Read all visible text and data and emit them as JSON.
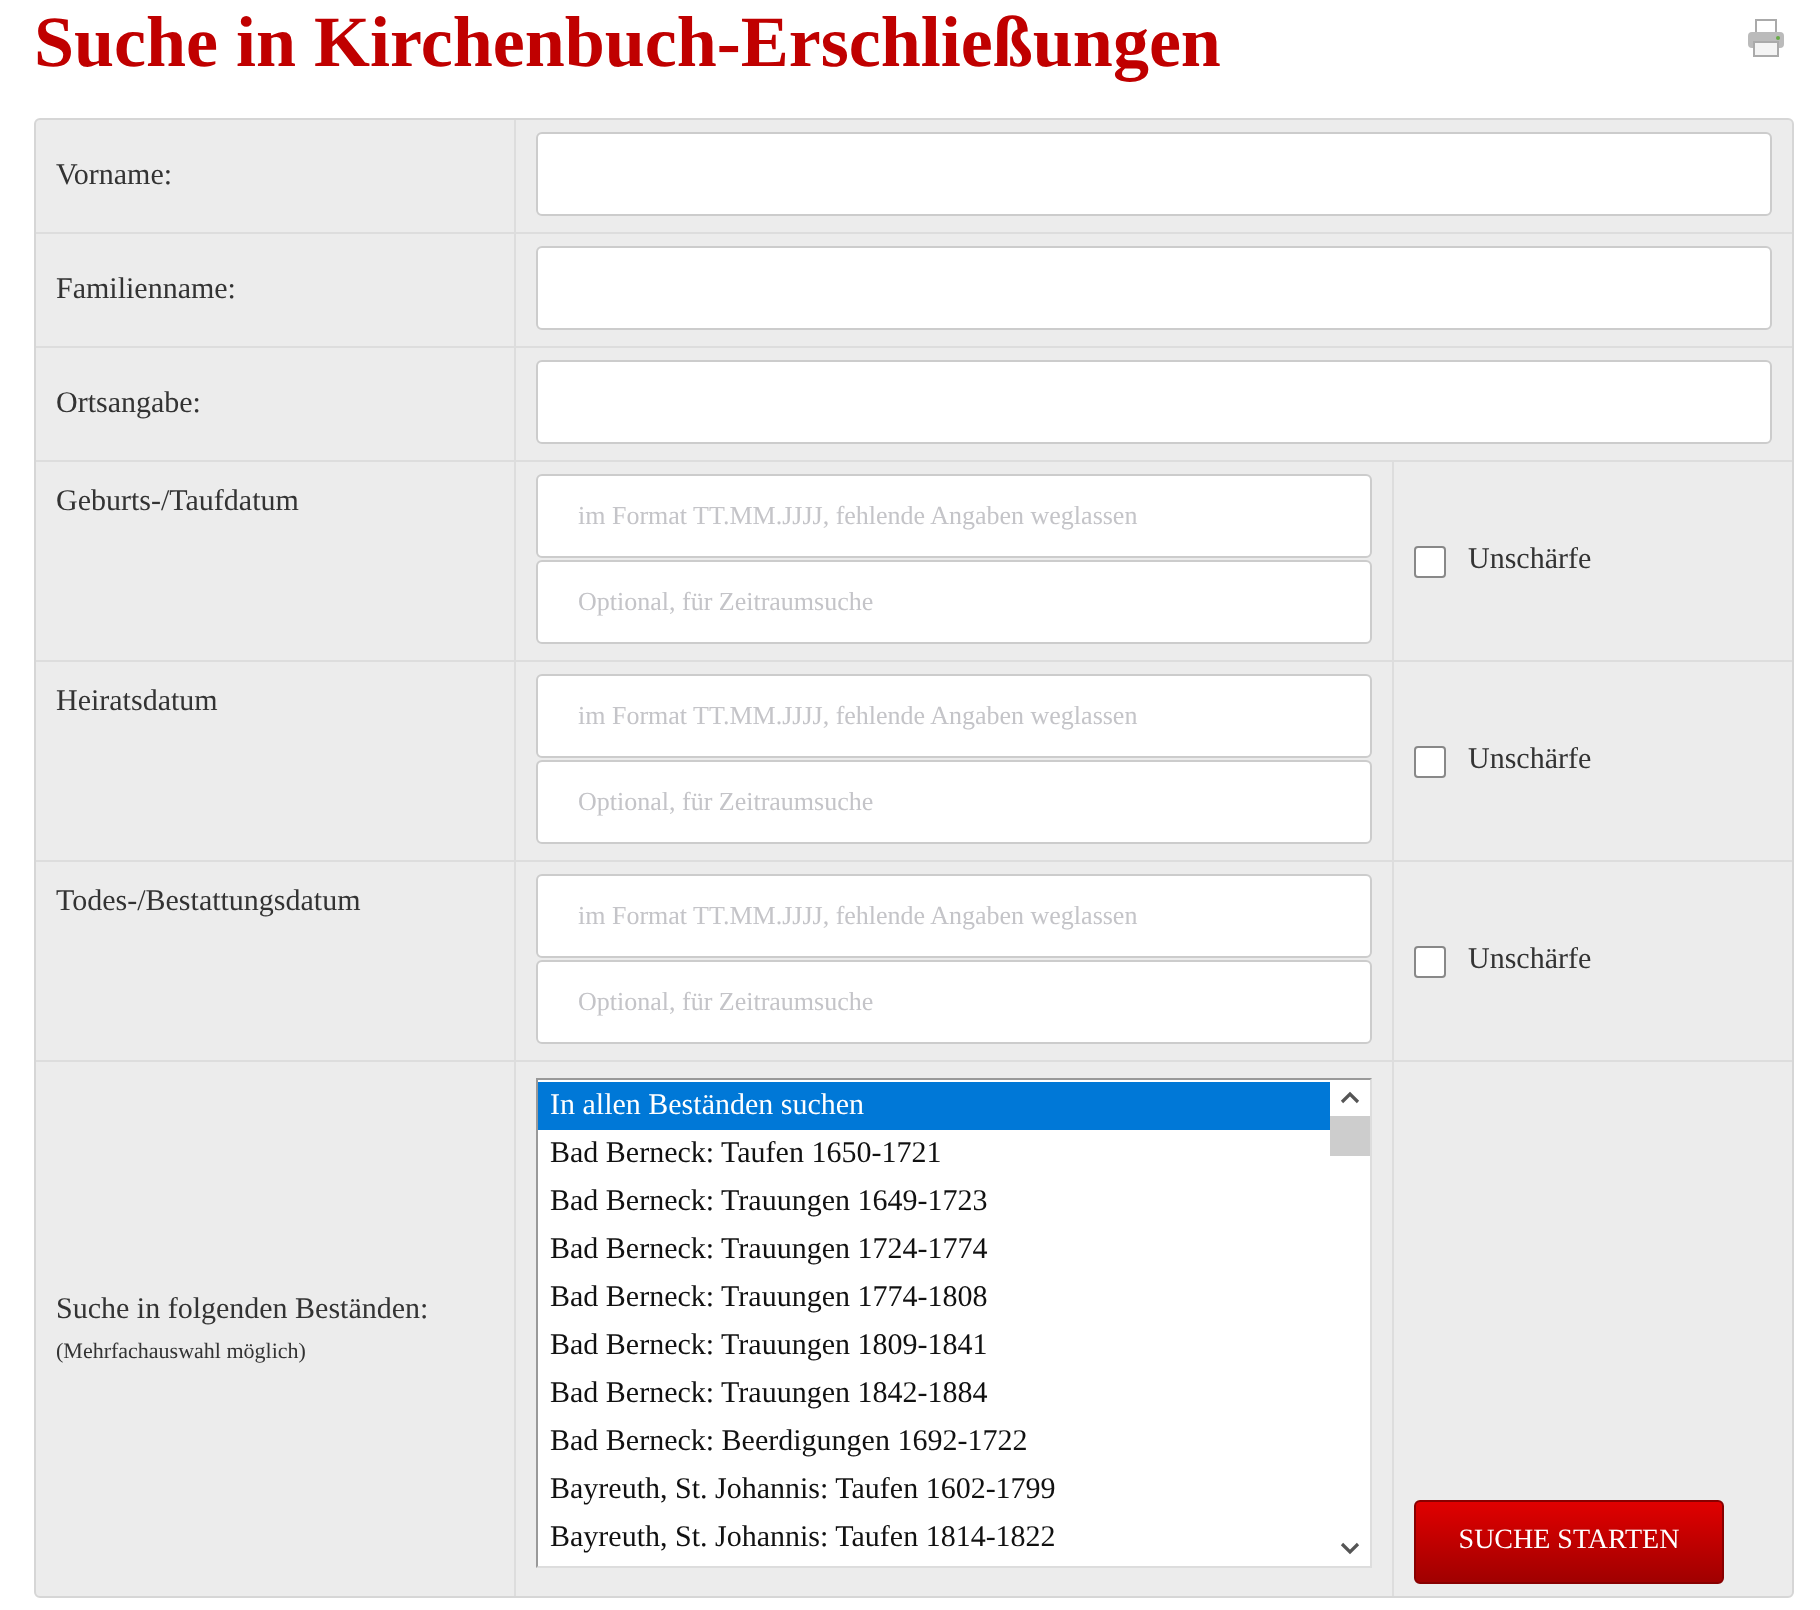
{
  "title": "Suche in Kirchenbuch-Erschließungen",
  "text_fields": [
    {
      "label": "Vorname:"
    },
    {
      "label": "Familienname:"
    },
    {
      "label": "Ortsangabe:"
    }
  ],
  "date_fields": [
    {
      "label": "Geburts-/Taufdatum",
      "from_placeholder": "im Format TT.MM.JJJJ, fehlende Angaben weglassen",
      "to_placeholder": "Optional, für Zeitraumsuche",
      "fuzzy_label": "Unschärfe",
      "checked": false
    },
    {
      "label": "Heiratsdatum",
      "from_placeholder": "im Format TT.MM.JJJJ, fehlende Angaben weglassen",
      "to_placeholder": "Optional, für Zeitraumsuche",
      "fuzzy_label": "Unschärfe",
      "checked": false
    },
    {
      "label": "Todes-/Bestattungsdatum",
      "from_placeholder": "im Format TT.MM.JJJJ, fehlende Angaben weglassen",
      "to_placeholder": "Optional, für Zeitraumsuche",
      "fuzzy_label": "Unschärfe",
      "checked": false
    }
  ],
  "collections": {
    "label": "Suche in folgenden Beständen:",
    "hint": "(Mehrfachauswahl möglich)",
    "items": [
      {
        "text": "In allen Beständen suchen",
        "selected": true
      },
      {
        "text": "Bad Berneck: Taufen 1650-1721",
        "selected": false
      },
      {
        "text": "Bad Berneck: Trauungen 1649-1723",
        "selected": false
      },
      {
        "text": "Bad Berneck: Trauungen 1724-1774",
        "selected": false
      },
      {
        "text": "Bad Berneck: Trauungen 1774-1808",
        "selected": false
      },
      {
        "text": "Bad Berneck: Trauungen 1809-1841",
        "selected": false
      },
      {
        "text": "Bad Berneck: Trauungen 1842-1884",
        "selected": false
      },
      {
        "text": "Bad Berneck: Beerdigungen 1692-1722",
        "selected": false
      },
      {
        "text": "Bayreuth, St. Johannis: Taufen 1602-1799",
        "selected": false
      },
      {
        "text": "Bayreuth, St. Johannis: Taufen 1814-1822",
        "selected": false
      }
    ]
  },
  "submit_button": "SUCHE STARTEN"
}
